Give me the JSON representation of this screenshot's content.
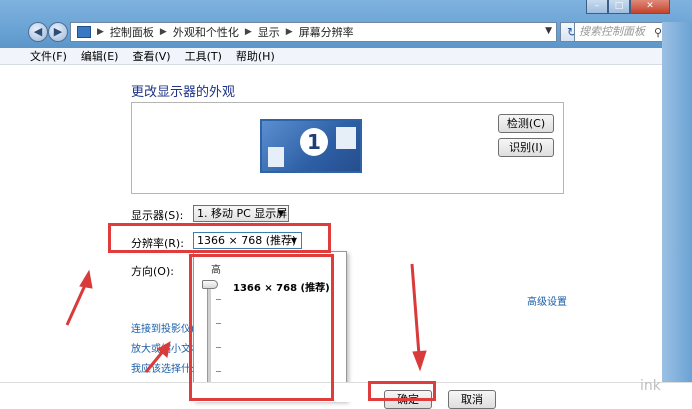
{
  "address_bar": {
    "crumbs": [
      "控制面板",
      "外观和个性化",
      "显示",
      "屏幕分辨率"
    ],
    "search_placeholder": "搜索控制面板"
  },
  "menu": [
    "文件(F)",
    "编辑(E)",
    "查看(V)",
    "工具(T)",
    "帮助(H)"
  ],
  "page": {
    "heading": "更改显示器的外观",
    "detect_button": "检测(C)",
    "identify_button": "识别(I)",
    "monitor_number": "1",
    "display_label": "显示器(S):",
    "display_value": "1. 移动 PC 显示屏",
    "resolution_label": "分辨率(R):",
    "resolution_value": "1366 × 768 (推荐)",
    "orientation_label": "方向(O):",
    "advanced_link": "高级设置",
    "links": [
      "连接到投影仪(",
      "放大或缩小文本",
      "我应该选择什么"
    ],
    "ok_button": "确定",
    "cancel_button": "取消"
  },
  "resolution_dropdown": {
    "high_label": "高",
    "option": "1366 × 768 (推荐)",
    "slider_level": 1.0
  },
  "watermark": "ink"
}
